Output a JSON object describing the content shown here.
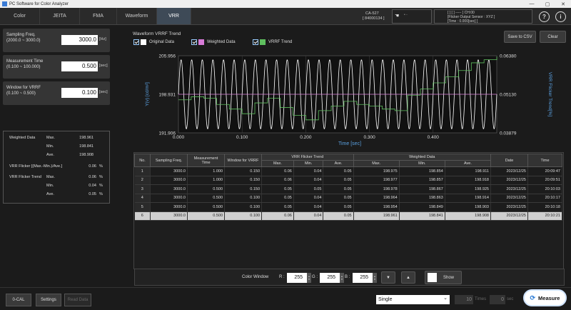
{
  "window": {
    "title": "PC Software for Color Analyzer",
    "controls": [
      "—",
      "▢",
      "✕"
    ]
  },
  "tabs": [
    {
      "label": "Color"
    },
    {
      "label": "JEITA"
    },
    {
      "label": "FMA"
    },
    {
      "label": "Waveform"
    },
    {
      "label": "VRR"
    }
  ],
  "device": {
    "model": "CA-527",
    "serial": "[ 84000134 ]",
    "probe_line1": "[          ]  [   ]   -----  ] CH:00",
    "probe_line2": "[Flicker Output Sensor   : XYZ    ]",
    "probe_line3": "[Time : 0.000[sec]               ]"
  },
  "params": {
    "sampling": {
      "label1": "Sampling Freq.",
      "label2": "(2000.0 ~ 3000.0)",
      "value": "3000.0",
      "unit": "[Hz]"
    },
    "measurement": {
      "label1": "Measurement Time",
      "label2": "(0.100 ~ 100.000)",
      "value": "0.500",
      "unit": "[sec]"
    },
    "window": {
      "label1": "Window for VRRF",
      "label2": "(0.100 ~ 0.500)",
      "value": "0.100",
      "unit": "[sec]"
    }
  },
  "stats": {
    "weighted_label": "Weighted Data",
    "max_label": "Max.",
    "min_label": "Min.",
    "ave_label": "Ave.",
    "w_max": "198.961",
    "w_min": "198.841",
    "w_ave": "198.908",
    "flicker_label": "VRR Flicker [(Max.-Min.)/Ave.]",
    "flicker_value": "0.06",
    "pct": "%",
    "trend_label": "VRR Flicker Trend",
    "t_max": "0.06",
    "t_min": "0.04",
    "t_ave": "0.05"
  },
  "chart_header": {
    "title": "Waveform VRRF Trend",
    "legend": [
      "Original Data",
      "Weighted Data",
      "VRRF Trend"
    ],
    "save_csv": "Save to CSV",
    "clear": "Clear"
  },
  "chart_data": {
    "type": "line",
    "xlabel": "Time [sec]",
    "ylabel": "Y(v) [cd/m²]",
    "y2label": "VRR Flicker Trend[%]",
    "xlim": [
      0.0,
      0.5
    ],
    "ylim": [
      191.906,
      205.956
    ],
    "y2lim": [
      0.03879,
      0.0638
    ],
    "xticks": [
      "0.000",
      "0.100",
      "0.200",
      "0.300",
      "0.400"
    ],
    "yticks": [
      "205.956",
      "198.931",
      "191.906"
    ],
    "y2ticks": [
      "0.06380",
      "0.05130",
      "0.03879"
    ],
    "original": {
      "name": "Original Data",
      "color": "#ffffff",
      "amplitude": 6.3,
      "center": 198.93,
      "frequency_hz": 60
    },
    "weighted": {
      "name": "Weighted Data",
      "color": "#d87bd8",
      "value": 198.93
    },
    "trend": {
      "name": "VRRF Trend",
      "color": "#5fbf5f",
      "x": [
        0.0,
        0.02,
        0.04,
        0.06,
        0.08,
        0.1,
        0.12,
        0.14,
        0.16,
        0.18,
        0.2,
        0.22,
        0.24,
        0.26,
        0.28,
        0.3,
        0.32,
        0.34,
        0.36,
        0.38,
        0.4,
        0.42,
        0.44,
        0.46,
        0.48,
        0.5
      ],
      "y": [
        0.0495,
        0.0505,
        0.05,
        0.048,
        0.0465,
        0.045,
        0.0485,
        0.05,
        0.047,
        0.0445,
        0.043,
        0.046,
        0.0475,
        0.049,
        0.048,
        0.0475,
        0.0465,
        0.046,
        0.051,
        0.053,
        0.055,
        0.057,
        0.059,
        0.0615,
        0.0625,
        0.0635
      ]
    }
  },
  "table": {
    "headers": {
      "no": "No.",
      "freq": "Sampling Freq.",
      "mtime": "Measurement Time",
      "window": "Window for VRRF",
      "trend": "VRR Flicker Trend",
      "weighted": "Weighted Data",
      "max": "Max.",
      "min": "Min.",
      "ave": "Ave.",
      "date": "Date",
      "time": "Time"
    },
    "rows": [
      [
        "1",
        "3000.0",
        "1.000",
        "0.150",
        "0.06",
        "0.04",
        "0.05",
        "198.975",
        "198.854",
        "198.911",
        "2023/12/25",
        "20:09:47"
      ],
      [
        "2",
        "3000.0",
        "1.000",
        "0.150",
        "0.06",
        "0.04",
        "0.05",
        "198.977",
        "198.857",
        "198.918",
        "2023/12/25",
        "20:09:51"
      ],
      [
        "3",
        "3000.0",
        "0.500",
        "0.150",
        "0.05",
        "0.05",
        "0.05",
        "198.978",
        "198.867",
        "198.925",
        "2023/12/25",
        "20:10:03"
      ],
      [
        "4",
        "3000.0",
        "0.500",
        "0.100",
        "0.05",
        "0.04",
        "0.05",
        "198.964",
        "198.863",
        "198.914",
        "2023/12/25",
        "20:10:17"
      ],
      [
        "5",
        "3000.0",
        "0.500",
        "0.100",
        "0.05",
        "0.04",
        "0.05",
        "198.954",
        "198.849",
        "198.903",
        "2023/12/25",
        "20:10:18"
      ],
      [
        "6",
        "3000.0",
        "0.500",
        "0.100",
        "0.06",
        "0.04",
        "0.05",
        "198.961",
        "198.841",
        "198.908",
        "2023/12/25",
        "20:10:21"
      ]
    ]
  },
  "color_window": {
    "label": "Color Window",
    "r_label": "R :",
    "g_label": "G :",
    "b_label": "B :",
    "r": "255",
    "g": "255",
    "b": "255",
    "show": "Show",
    "down": "▼",
    "up": "▲"
  },
  "bottom": {
    "zero_cal": "0-CAL",
    "settings": "Settings",
    "read_data": "Read Data",
    "mode": "Single",
    "times_value": "10",
    "times_unit": "Times",
    "interval_value": "0",
    "interval_unit": "sec",
    "measure": "Measure"
  }
}
